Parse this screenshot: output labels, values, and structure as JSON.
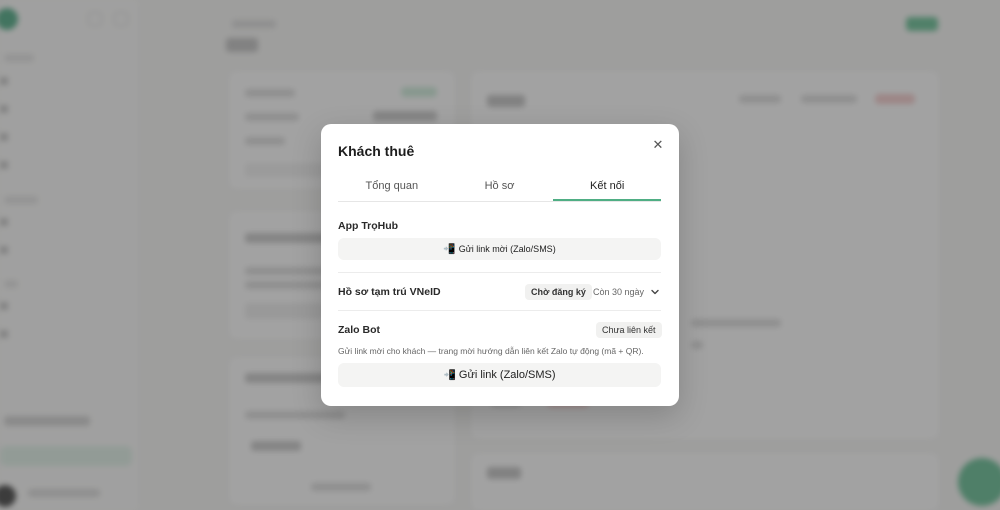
{
  "modal": {
    "title": "Khách thuê",
    "tabs": [
      {
        "label": "Tổng quan",
        "active": false
      },
      {
        "label": "Hồ sơ",
        "active": false
      },
      {
        "label": "Kết nối",
        "active": true
      }
    ],
    "close_icon": "close-icon",
    "app_section": {
      "label": "App TrọHub",
      "button_icon": "📲",
      "button_label": "Gửi link mời (Zalo/SMS)"
    },
    "vneid_section": {
      "label": "Hồ sơ tạm trú VNeID",
      "status_badge": "Chờ đăng ký",
      "remaining": "Còn 30 ngày"
    },
    "zalo_section": {
      "label": "Zalo Bot",
      "status_badge": "Chưa liên kết",
      "hint": "Gửi link mời cho khách — trang mời hướng dẫn liên kết Zalo tự động (mã + QR).",
      "button_icon": "📲",
      "button_label": "Gửi link (Zalo/SMS)"
    }
  },
  "colors": {
    "accent": "#4fae84",
    "overlay": "rgba(70,70,70,0.5)",
    "badge_bg": "#f1f1f0"
  }
}
